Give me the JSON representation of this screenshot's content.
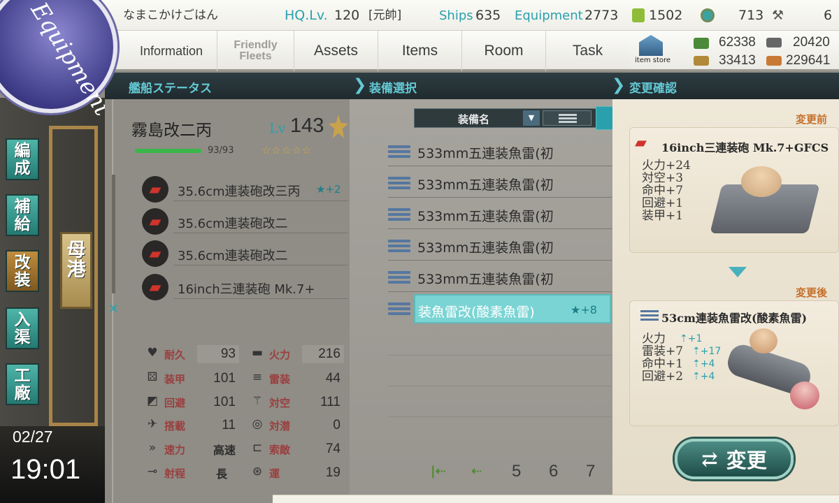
{
  "top": {
    "admiral_name": "なまこかけごはん",
    "hq_label": "HQ.Lv.",
    "hq_level": "120",
    "rank": "[元帥]",
    "ships_label": "Ships",
    "ships_value": "635",
    "equipment_label": "Equipment",
    "equipment_value": "2773",
    "bucket_value": "1502",
    "devmat_value": "713",
    "screw_value": "6"
  },
  "nav": {
    "information": "Information",
    "friendly_fleets": "Friendly Fleets",
    "assets": "Assets",
    "items": "Items",
    "room": "Room",
    "task": "Task",
    "item_store": "item store"
  },
  "resources": {
    "fuel": "62338",
    "ammo": "20420",
    "steel": "33413",
    "bauxite": "229641"
  },
  "badge": {
    "title": "Equipment"
  },
  "sections": {
    "ship_status": "艦船ステータス",
    "equip_select": "装備選択",
    "change_confirm": "変更確認"
  },
  "side_menu": {
    "organize": "編成",
    "supply": "補給",
    "remodel": "改装",
    "repair": "入渠",
    "arsenal": "工廠",
    "port": "母港",
    "date": "02/27",
    "time": "19:01"
  },
  "ship": {
    "name": "霧島改二丙",
    "lv_label": "Lv",
    "level": "143",
    "hp": "93/93",
    "stars": "☆☆☆☆☆",
    "slots": [
      {
        "name": "35.6cm連装砲改三丙",
        "proficiency": "★+2"
      },
      {
        "name": "35.6cm連装砲改二",
        "proficiency": ""
      },
      {
        "name": "35.6cm連装砲改二",
        "proficiency": ""
      },
      {
        "name": "16inch三連装砲 Mk.7+",
        "proficiency": ""
      }
    ],
    "stats": {
      "hp_label": "耐久",
      "hp": "93",
      "firepower_label": "火力",
      "firepower": "216",
      "armor_label": "装甲",
      "armor": "101",
      "torpedo_label": "雷装",
      "torpedo": "44",
      "evasion_label": "回避",
      "evasion": "101",
      "aa_label": "対空",
      "aa": "111",
      "aircraft_label": "搭載",
      "aircraft": "11",
      "asw_label": "対潜",
      "asw": "0",
      "speed_label": "速力",
      "speed": "高速",
      "los_label": "索敵",
      "los": "74",
      "range_label": "射程",
      "range": "長",
      "luck_label": "運",
      "luck": "19"
    }
  },
  "equip_list": {
    "header": "装備名",
    "items": [
      {
        "name": "533mm五連装魚雷(初"
      },
      {
        "name": "533mm五連装魚雷(初"
      },
      {
        "name": "533mm五連装魚雷(初"
      },
      {
        "name": "533mm五連装魚雷(初"
      },
      {
        "name": "533mm五連装魚雷(初"
      },
      {
        "name": "装魚雷改(酸素魚雷)",
        "proficiency": "★+8"
      }
    ],
    "pages": [
      "5",
      "6",
      "7"
    ]
  },
  "confirm": {
    "before_label": "変更前",
    "after_label": "変更後",
    "before_name": "16inch三連装砲 Mk.7+GFCS",
    "before_stats": [
      "火力+24",
      "対空+3",
      "命中+7",
      "回避+1",
      "装甲+1"
    ],
    "after_name": "53cm連装魚雷改(酸素魚雷)",
    "after_stats": [
      "火力",
      "雷装+7",
      "命中+1",
      "回避+2"
    ],
    "after_upgrades": [
      "+1",
      "+17",
      "+4",
      "+4"
    ],
    "change_button": "変更"
  },
  "colors": {
    "accent": "#2aa0ad",
    "section_text": "#63c9d4",
    "selected_row": "#7bd4d4",
    "button": "#2d5751"
  }
}
